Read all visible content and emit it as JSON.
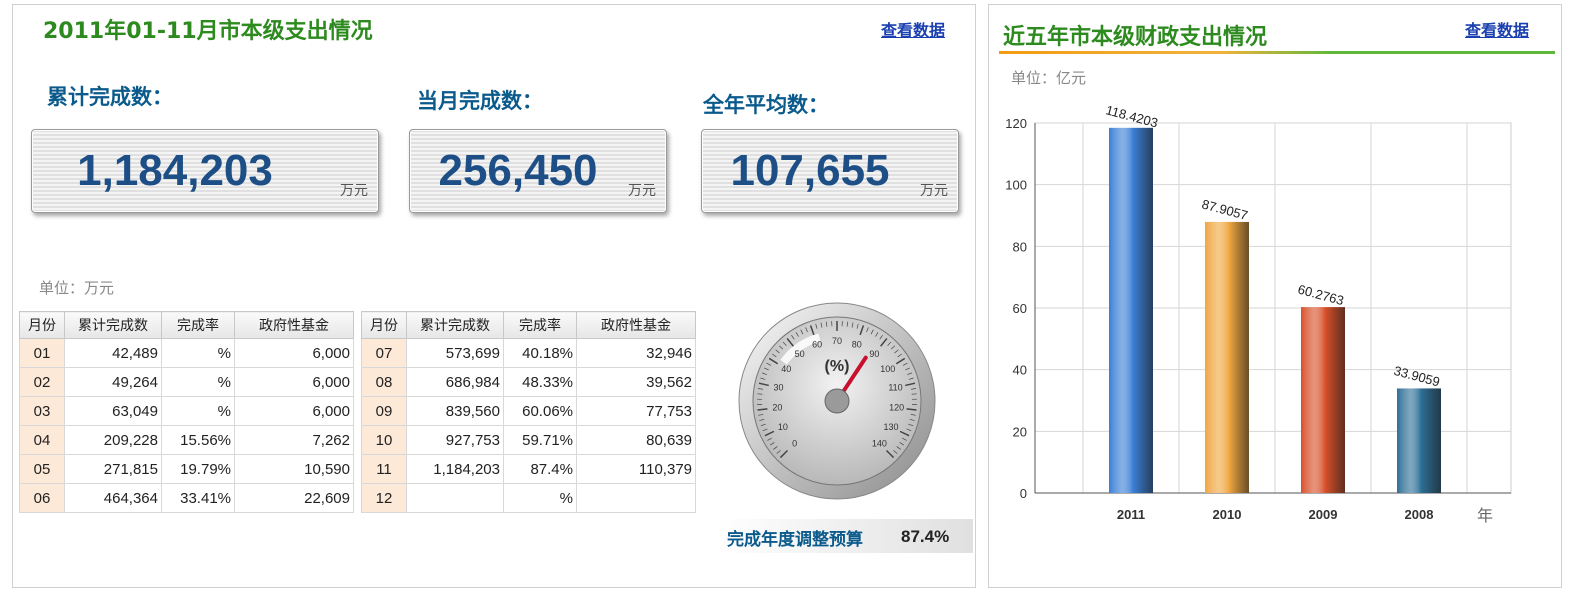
{
  "left": {
    "title": "2011年01-11月市本级支出情况",
    "view_link": "查看数据",
    "stats": [
      {
        "label": "累计完成数：",
        "value": "1,184,203",
        "unit": "万元"
      },
      {
        "label": "当月完成数：",
        "value": "256,450",
        "unit": "万元"
      },
      {
        "label": "全年平均数：",
        "value": "107,655",
        "unit": "万元"
      }
    ],
    "unit_note": "单位：万元",
    "table_headers": [
      "月份",
      "累计完成数",
      "完成率",
      "政府性基金"
    ],
    "table1": [
      [
        "01",
        "42,489",
        "%",
        "6,000"
      ],
      [
        "02",
        "49,264",
        "%",
        "6,000"
      ],
      [
        "03",
        "63,049",
        "%",
        "6,000"
      ],
      [
        "04",
        "209,228",
        "15.56%",
        "7,262"
      ],
      [
        "05",
        "271,815",
        "19.79%",
        "10,590"
      ],
      [
        "06",
        "464,364",
        "33.41%",
        "22,609"
      ]
    ],
    "table2": [
      [
        "07",
        "573,699",
        "40.18%",
        "32,946"
      ],
      [
        "08",
        "686,984",
        "48.33%",
        "39,562"
      ],
      [
        "09",
        "839,560",
        "60.06%",
        "77,753"
      ],
      [
        "10",
        "927,753",
        "59.71%",
        "80,639"
      ],
      [
        "11",
        "1,184,203",
        "87.4%",
        "110,379"
      ],
      [
        "12",
        "",
        "%",
        ""
      ]
    ],
    "gauge": {
      "center_label": "(%)",
      "value": 87.4,
      "ticks": [
        "0",
        "10",
        "20",
        "30",
        "40",
        "50",
        "60",
        "70",
        "80",
        "90",
        "100",
        "110",
        "120",
        "130",
        "140"
      ],
      "caption": "完成年度调整预算",
      "caption_value": "87.4%"
    }
  },
  "right": {
    "title": "近五年市本级财政支出情况",
    "view_link": "查看数据",
    "unit": "单位：亿元",
    "chart_data": {
      "type": "bar",
      "categories": [
        "2011",
        "2010",
        "2009",
        "2008"
      ],
      "values": [
        118.4203,
        87.9057,
        60.2763,
        33.9059
      ],
      "value_labels": [
        "118.4203",
        "87.9057",
        "60.2763",
        "33.9059"
      ],
      "yticks": [
        "0",
        "20",
        "40",
        "60",
        "80",
        "100",
        "120"
      ],
      "ylim": [
        0,
        120
      ],
      "xlabel": "年",
      "grid": true,
      "colors": [
        "#3a7fd6",
        "#f0a640",
        "#d8502a",
        "#2d6f96"
      ]
    }
  }
}
